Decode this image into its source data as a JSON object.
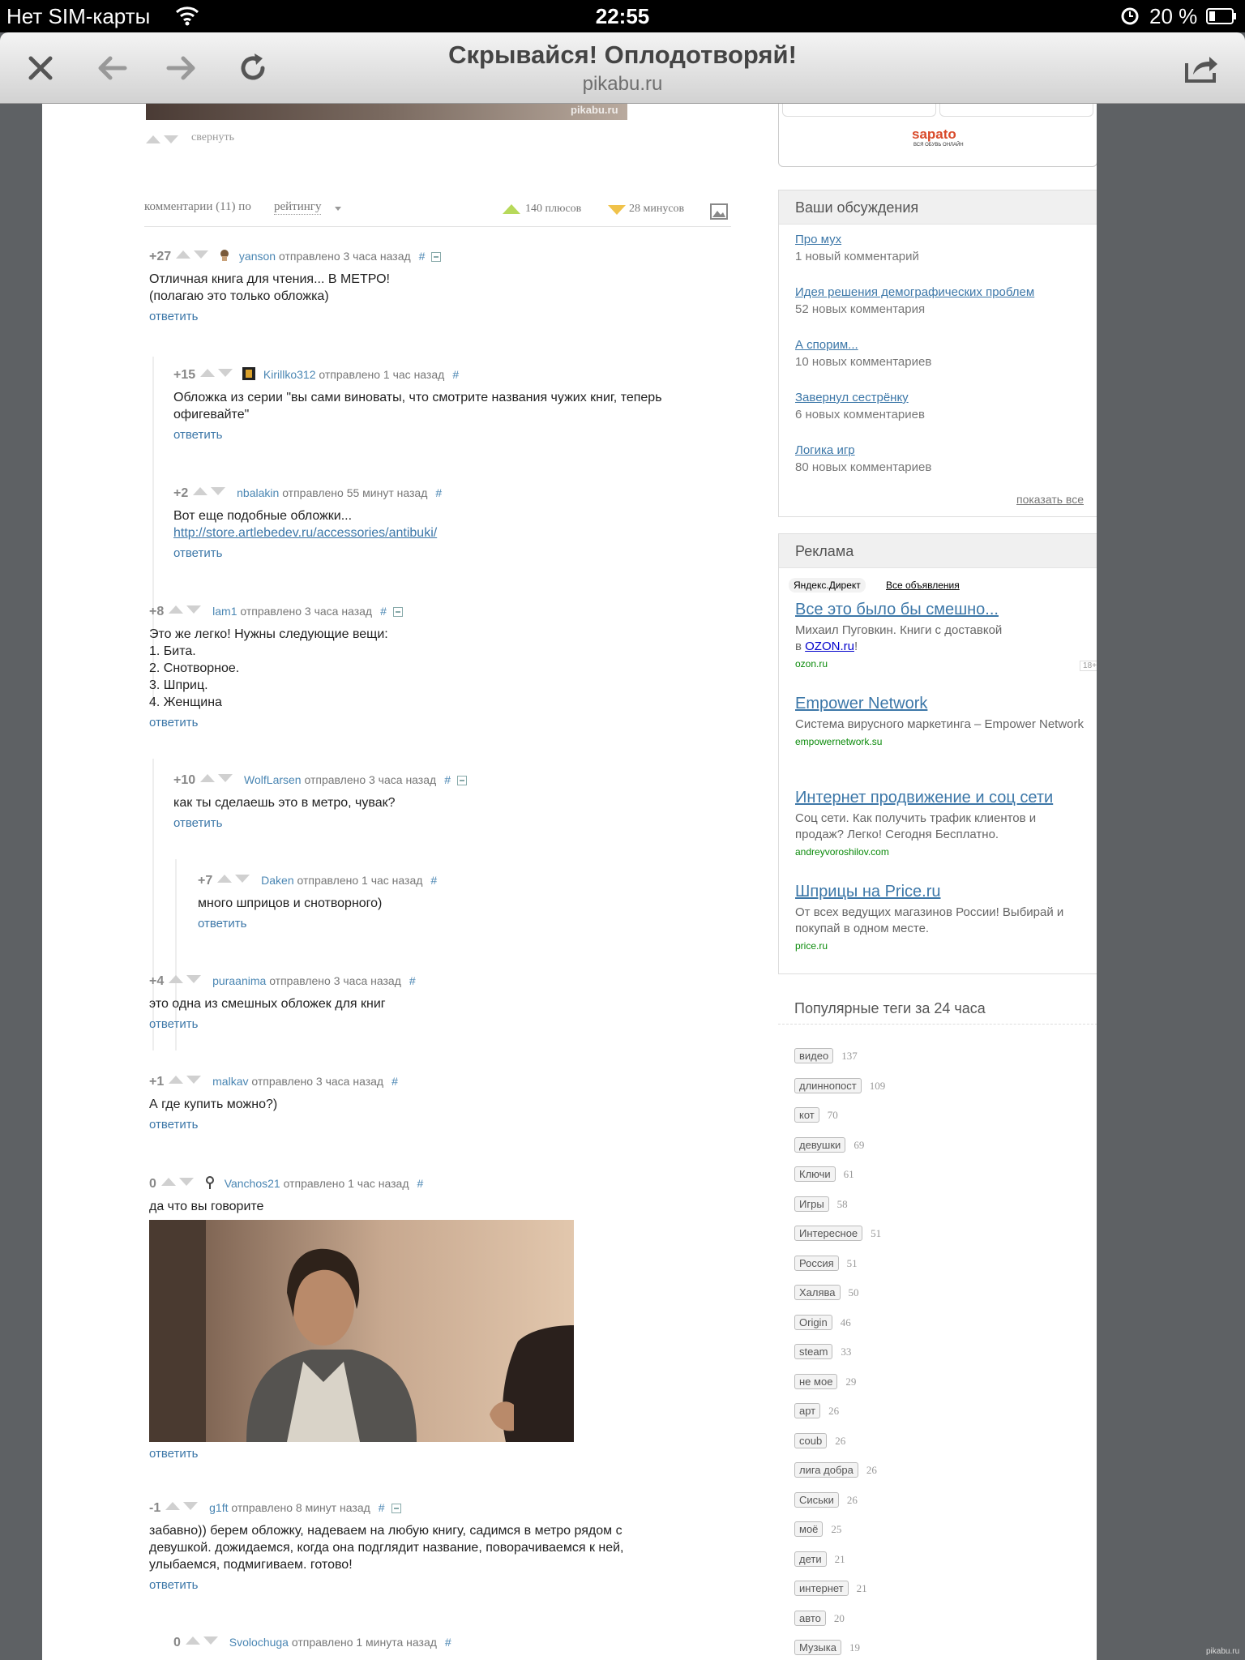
{
  "status": {
    "carrier": "Нет SIM-карты",
    "time": "22:55",
    "battery": "20 %"
  },
  "toolbar": {
    "title": "Скрывайся! Оплодотворяй!",
    "url": "pikabu.ru"
  },
  "post": {
    "collapse": "свернуть",
    "watermark": "pikabu.ru"
  },
  "comments_bar": {
    "label": "комментарии (11) по",
    "sort": "рейтингу",
    "pluses": "140 плюсов",
    "minuses": "28 минусов"
  },
  "comments": [
    {
      "rating": "+27",
      "author": "yanson",
      "meta": "отправлено 3 часа назад",
      "hash": "#",
      "text": [
        "Отличная книга для чтения... В МЕТРО!",
        "(полагаю это только обложка)"
      ],
      "reply": "ответить"
    },
    {
      "rating": "+15",
      "author": "Kirillko312",
      "meta": "отправлено 1 час назад",
      "hash": "#",
      "text": [
        "Обложка из серии \"вы сами виноваты, что смотрите названия чужих книг, теперь офигевайте\""
      ],
      "reply": "ответить"
    },
    {
      "rating": "+2",
      "author": "nbalakin",
      "meta": "отправлено 55 минут назад",
      "hash": "#",
      "text": [
        "Вот еще подобные обложки..."
      ],
      "link": "http://store.artlebedev.ru/accessories/antibuki/",
      "reply": "ответить"
    },
    {
      "rating": "+8",
      "author": "lam1",
      "meta": "отправлено 3 часа назад",
      "hash": "#",
      "text": [
        "Это же легко! Нужны следующие вещи:",
        "1. Бита.",
        "2. Снотворное.",
        "3. Шприц.",
        "4. Женщина"
      ],
      "reply": "ответить"
    },
    {
      "rating": "+10",
      "author": "WolfLarsen",
      "meta": "отправлено 3 часа назад",
      "hash": "#",
      "text": [
        "как ты сделаешь это в метро, чувак?"
      ],
      "reply": "ответить"
    },
    {
      "rating": "+7",
      "author": "Daken",
      "meta": "отправлено 1 час назад",
      "hash": "#",
      "text": [
        "много шприцов и снотворного)"
      ],
      "reply": "ответить"
    },
    {
      "rating": "+4",
      "author": "puraanima",
      "meta": "отправлено 3 часа назад",
      "hash": "#",
      "text": [
        "это одна из смешных обложек для книг"
      ],
      "reply": "ответить"
    },
    {
      "rating": "+1",
      "author": "malkav",
      "meta": "отправлено 3 часа назад",
      "hash": "#",
      "text": [
        "А где купить можно?)"
      ],
      "reply": "ответить"
    },
    {
      "rating": "0",
      "author": "Vanchos21",
      "meta": "отправлено 1 час назад",
      "hash": "#",
      "text": [
        "да что вы говорите"
      ],
      "reply": "ответить"
    },
    {
      "rating": "-1",
      "author": "g1ft",
      "meta": "отправлено 8 минут назад",
      "hash": "#",
      "text": [
        "забавно)) берем обложку, надеваем на любую книгу, садимся в метро рядом с",
        "девушкой. дожидаемся, когда она подглядит название, поворачиваемся к ней,",
        "улыбаемся, подмигиваем. готово!"
      ],
      "reply": "ответить"
    },
    {
      "rating": "0",
      "author": "Svolochuga",
      "meta": "отправлено 1 минута назад",
      "hash": "#",
      "text": [],
      "reply": ""
    }
  ],
  "discussions": {
    "title": "Ваши обсуждения",
    "items": [
      {
        "title": "Про мух",
        "sub": "1 новый комментарий"
      },
      {
        "title": "Идея решения демографических проблем",
        "sub": "52 новых комментария"
      },
      {
        "title": "А спорим...",
        "sub": "10 новых комментариев"
      },
      {
        "title": "Завернул сестрёнку",
        "sub": "6 новых комментариев"
      },
      {
        "title": "Логика игр",
        "sub": "80 новых комментариев"
      }
    ],
    "show_all": "показать все"
  },
  "sapato": {
    "brand": "sapato",
    "slogan": "ВСЯ ОБУВЬ ОНЛАЙН"
  },
  "ads": {
    "title": "Реклама",
    "yandex": "Яндекс.Директ",
    "all": "Все объявления",
    "items": [
      {
        "title": "Все это было бы смешно...",
        "desc1": "Михаил Пуговкин. Книги с доставкой",
        "desc_prefix": "в ",
        "desc_link": "OZON.ru",
        "desc_suffix": "!",
        "url": "ozon.ru",
        "age": "18+"
      },
      {
        "title": "Empower Network",
        "desc": "Система вирусного маркетинга – Empower Network",
        "url": "empowernetwork.su"
      },
      {
        "title": "Интернет продвижение и соц сети",
        "desc": "Соц сети. Как получить трафик клиентов и продаж? Легко! Сегодня Бесплатно.",
        "url": "andreyvoroshilov.com"
      },
      {
        "title": "Шприцы на Price.ru",
        "desc": "От всех ведущих магазинов России! Выбирай и покупай в одном месте.",
        "url": "price.ru"
      }
    ]
  },
  "tags": {
    "title": "Популярные теги за 24 часа",
    "items": [
      {
        "name": "видео",
        "count": "137"
      },
      {
        "name": "длиннопост",
        "count": "109"
      },
      {
        "name": "кот",
        "count": "70"
      },
      {
        "name": "девушки",
        "count": "69"
      },
      {
        "name": "Ключи",
        "count": "61"
      },
      {
        "name": "Игры",
        "count": "58"
      },
      {
        "name": "Интересное",
        "count": "51"
      },
      {
        "name": "Россия",
        "count": "51"
      },
      {
        "name": "Халява",
        "count": "50"
      },
      {
        "name": "Origin",
        "count": "46"
      },
      {
        "name": "steam",
        "count": "33"
      },
      {
        "name": "не мое",
        "count": "29"
      },
      {
        "name": "арт",
        "count": "26"
      },
      {
        "name": "coub",
        "count": "26"
      },
      {
        "name": "лига добра",
        "count": "26"
      },
      {
        "name": "Сиськи",
        "count": "26"
      },
      {
        "name": "моё",
        "count": "25"
      },
      {
        "name": "дети",
        "count": "21"
      },
      {
        "name": "интернет",
        "count": "21"
      },
      {
        "name": "авто",
        "count": "20"
      },
      {
        "name": "Музыка",
        "count": "19"
      }
    ]
  },
  "footer_watermark": "pikabu.ru"
}
